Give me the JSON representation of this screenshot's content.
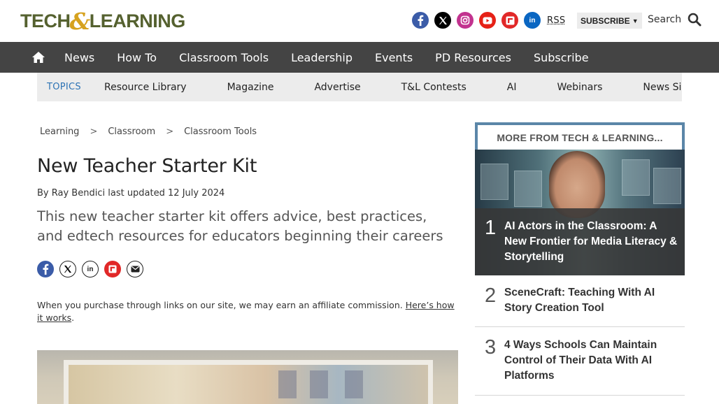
{
  "header": {
    "logo": {
      "part1": "TECH",
      "amp": "&",
      "part2": "LEARNING"
    },
    "socials": [
      {
        "name": "facebook-icon",
        "color": "#3b5ca8"
      },
      {
        "name": "x-twitter-icon",
        "color": "#000000"
      },
      {
        "name": "instagram-icon",
        "color": "#c2338f"
      },
      {
        "name": "youtube-icon",
        "color": "#e62117"
      },
      {
        "name": "flipboard-icon",
        "color": "#e12828"
      },
      {
        "name": "linkedin-icon",
        "color": "#0a66c2"
      }
    ],
    "rss_label": "RSS",
    "subscribe_label": "SUBSCRIBE",
    "search_label": "Search"
  },
  "nav": {
    "items": [
      "News",
      "How To",
      "Classroom Tools",
      "Leadership",
      "Events",
      "PD Resources",
      "Subscribe"
    ]
  },
  "topics": {
    "label": "TOPICS",
    "items": [
      "Resource Library",
      "Magazine",
      "Advertise",
      "T&L Contests",
      "AI",
      "Webinars",
      "News Sig"
    ]
  },
  "breadcrumb": {
    "items": [
      "Learning",
      "Classroom",
      "Classroom Tools"
    ],
    "separator": ">"
  },
  "article": {
    "title": "New Teacher Starter Kit",
    "byline_prefix": "By",
    "author": "Ray Bendici",
    "updated_label": "last updated",
    "updated_date": "12 July 2024",
    "standfirst": "This new teacher starter kit offers advice, best practices, and edtech resources for educators beginning their careers",
    "disclosure_text": "When you purchase through links on our site, we may earn an affiliate commission.",
    "disclosure_link": "Here’s how it works",
    "disclosure_end": "."
  },
  "share": [
    {
      "name": "share-facebook-icon",
      "color": "#3b5ca8"
    },
    {
      "name": "share-x-icon",
      "color": "#000000"
    },
    {
      "name": "share-linkedin-icon",
      "color": "#ffffff"
    },
    {
      "name": "share-flipboard-icon",
      "color": "#e12828"
    },
    {
      "name": "share-email-icon",
      "color": "#ffffff"
    }
  ],
  "sidebar": {
    "heading": "MORE FROM TECH & LEARNING...",
    "items": [
      {
        "num": "1",
        "title": "AI Actors in the Classroom: A New Frontier for Media Literacy & Storytelling"
      },
      {
        "num": "2",
        "title": "SceneCraft: Teaching With AI Story Creation Tool"
      },
      {
        "num": "3",
        "title": "4 Ways Schools Can Maintain Control of Their Data With AI Platforms"
      }
    ]
  },
  "colors": {
    "nav_bg": "#444444",
    "topics_label": "#2d73b5",
    "sidebar_border": "#5b86a8",
    "logo_green": "#55612f",
    "logo_amp": "#d6a21f"
  }
}
